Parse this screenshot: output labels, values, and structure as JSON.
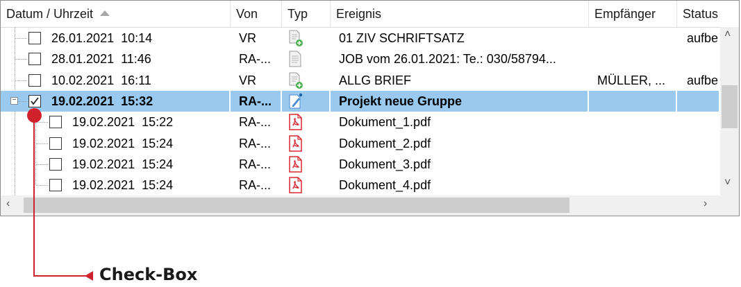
{
  "columns": [
    "Datum / Uhrzeit",
    "Von",
    "Typ",
    "Ereignis",
    "Empfänger",
    "Status"
  ],
  "rows": [
    {
      "date": "26.01.2021",
      "time": "10:14",
      "von": "VR",
      "type_icon": "document-add-icon",
      "ereignis": "01 ZIV SCHRIFTSATZ",
      "empfaenger": "",
      "status": "aufbe",
      "checked": false,
      "level": 1
    },
    {
      "date": "28.01.2021",
      "time": "11:46",
      "von": "RA-...",
      "type_icon": "document-icon",
      "ereignis": "JOB vom 26.01.2021: Te.: 030/58794...",
      "empfaenger": "",
      "status": "",
      "checked": false,
      "level": 1
    },
    {
      "date": "10.02.2021",
      "time": "16:11",
      "von": "VR",
      "type_icon": "document-add-icon",
      "ereignis": "ALLG BRIEF",
      "empfaenger": "MÜLLER, ...",
      "status": "aufbe",
      "checked": false,
      "level": 1
    },
    {
      "date": "19.02.2021",
      "time": "15:32",
      "von": "RA-...",
      "type_icon": "edit-document-icon",
      "ereignis": "Projekt neue Gruppe",
      "empfaenger": "",
      "status": "",
      "checked": true,
      "level": 1,
      "selected": true
    },
    {
      "date": "19.02.2021",
      "time": "15:22",
      "von": "RA-...",
      "type_icon": "pdf-icon",
      "ereignis": "Dokument_1.pdf",
      "empfaenger": "",
      "status": "",
      "checked": false,
      "level": 2
    },
    {
      "date": "19.02.2021",
      "time": "15:24",
      "von": "RA-...",
      "type_icon": "pdf-icon",
      "ereignis": "Dokument_2.pdf",
      "empfaenger": "",
      "status": "",
      "checked": false,
      "level": 2
    },
    {
      "date": "19.02.2021",
      "time": "15:24",
      "von": "RA-...",
      "type_icon": "pdf-icon",
      "ereignis": "Dokument_3.pdf",
      "empfaenger": "",
      "status": "",
      "checked": false,
      "level": 2
    },
    {
      "date": "19.02.2021",
      "time": "15:24",
      "von": "RA-...",
      "type_icon": "pdf-icon",
      "ereignis": "Dokument_4.pdf",
      "empfaenger": "",
      "status": "",
      "checked": false,
      "level": 2
    }
  ],
  "callout": {
    "label": "Check-Box"
  },
  "scroll_icons": {
    "up": "chevron-up-icon",
    "down": "chevron-down-icon",
    "left": "chevron-left-icon",
    "right": "chevron-right-icon"
  },
  "colors": {
    "selection": "#99c9ef",
    "accent_red": "#d0202c",
    "pdf_red": "#d9262e"
  }
}
